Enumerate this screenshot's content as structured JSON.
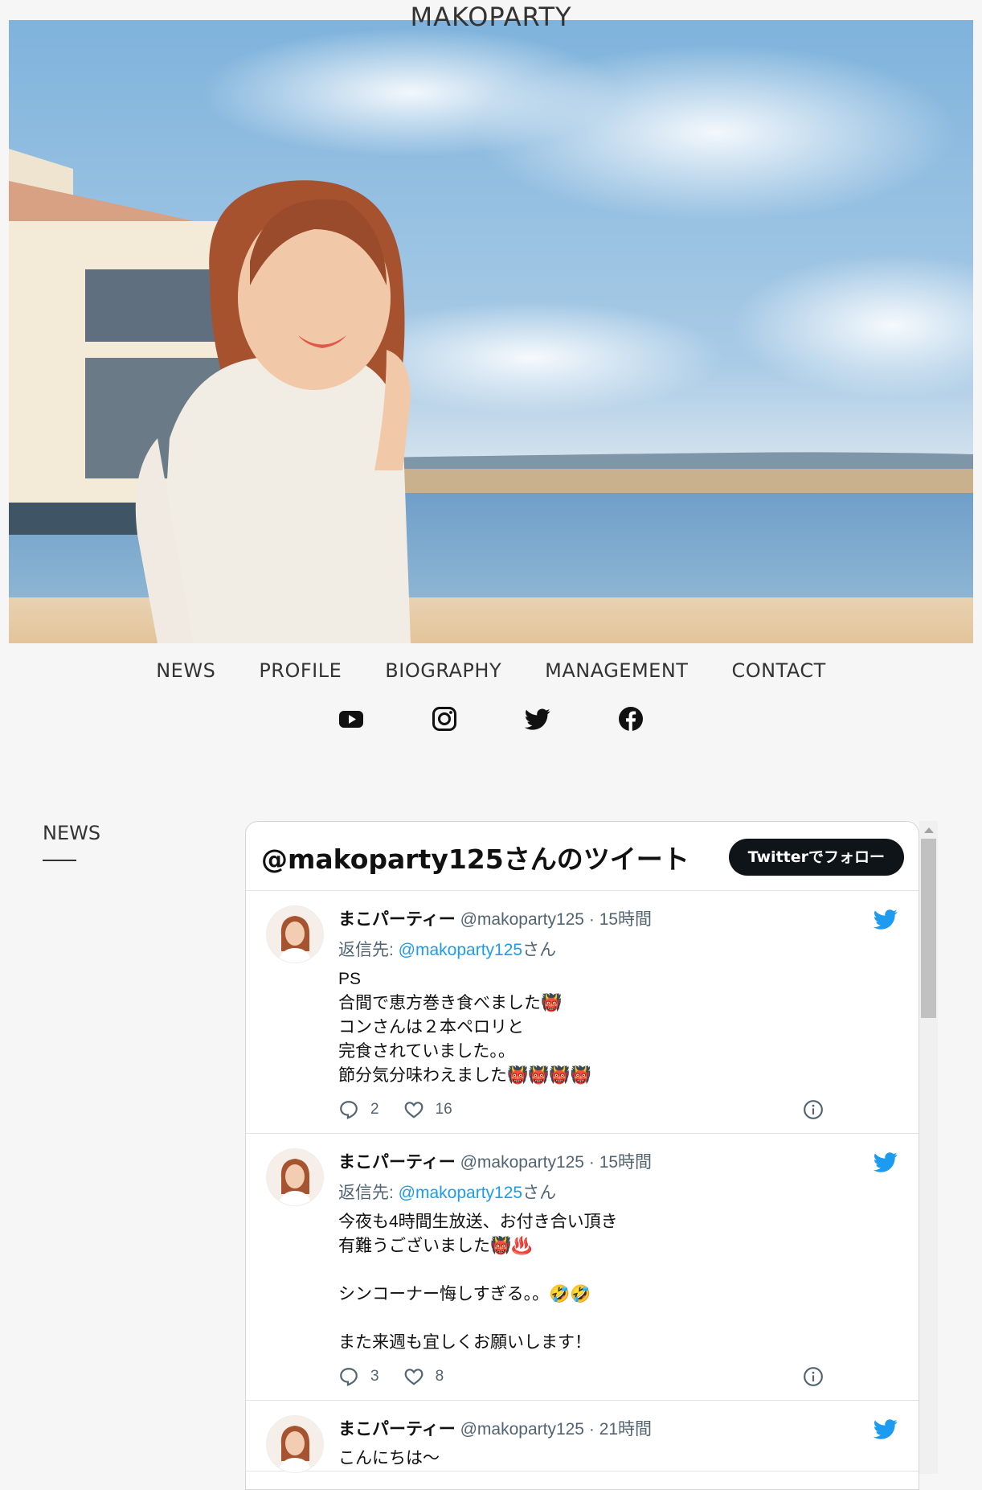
{
  "site": {
    "logo": "MAKOPARTY"
  },
  "nav": {
    "items": [
      {
        "label": "NEWS"
      },
      {
        "label": "PROFILE"
      },
      {
        "label": "BIOGRAPHY"
      },
      {
        "label": "MANAGEMENT"
      },
      {
        "label": "CONTACT"
      }
    ]
  },
  "social": [
    "youtube-icon",
    "instagram-icon",
    "twitter-icon",
    "facebook-icon"
  ],
  "news": {
    "heading": "NEWS"
  },
  "twitter_widget": {
    "title": "@makoparty125さんのツイート",
    "follow_label": "Twitterでフォロー",
    "tweets": [
      {
        "name": "まこパーティー",
        "handle": "@makoparty125",
        "time": "15時間",
        "reply_prefix": "返信先: ",
        "reply_mention": "@makoparty125",
        "reply_suffix": "さん",
        "text": "PS\n合間で恵方巻き食べました👹\nコンさんは２本ペロリと\n完食されていました。。\n節分気分味わえました👹👹👹👹",
        "replies": "2",
        "likes": "16"
      },
      {
        "name": "まこパーティー",
        "handle": "@makoparty125",
        "time": "15時間",
        "reply_prefix": "返信先: ",
        "reply_mention": "@makoparty125",
        "reply_suffix": "さん",
        "text": "今夜も4時間生放送、お付き合い頂き\n有難うございました👹♨️\n\nシンコーナー悔しすぎる。。🤣🤣\n\nまた来週も宜しくお願いします！",
        "replies": "3",
        "likes": "8"
      },
      {
        "name": "まこパーティー",
        "handle": "@makoparty125",
        "time": "21時間",
        "text": "こんにちは～"
      }
    ]
  },
  "colors": {
    "twitter_blue": "#1d9bf0",
    "follow_button": "#0f1419",
    "page_bg": "#f6f6f6"
  }
}
